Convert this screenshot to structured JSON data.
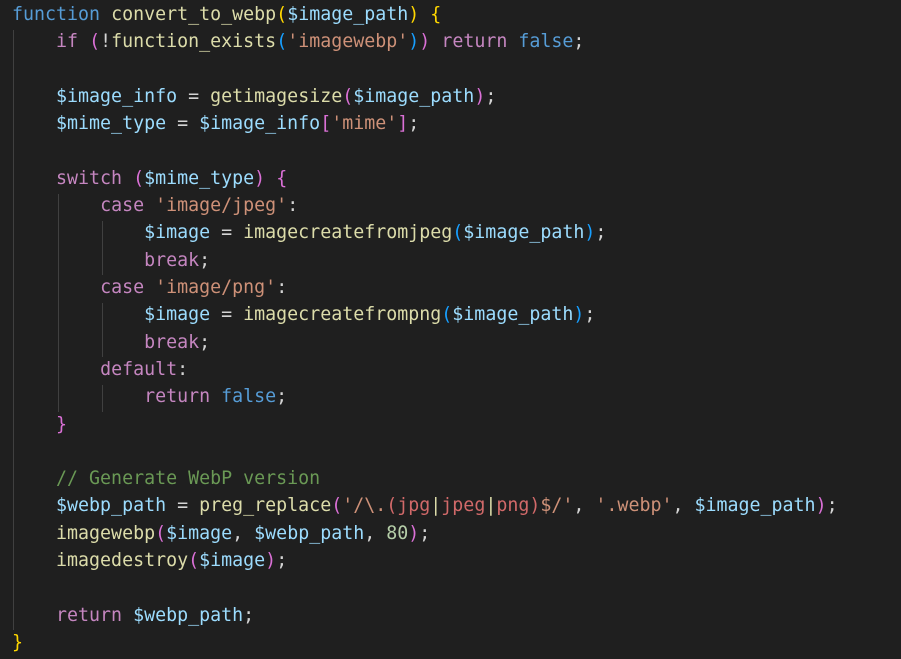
{
  "editor": {
    "language": "php",
    "theme_colors": {
      "background": "#1f1f1f",
      "keyword": "#569cd6",
      "control": "#c586c0",
      "function": "#dcdcaa",
      "variable": "#9cdcfe",
      "string": "#ce9178",
      "regex": "#d16969",
      "number": "#b5cea8",
      "comment": "#6a9955",
      "bracket_1": "#ffd700",
      "bracket_2": "#da70d6",
      "bracket_3": "#179fff"
    },
    "lines": [
      [
        [
          "kw",
          "function"
        ],
        [
          "op",
          " "
        ],
        [
          "fn",
          "convert_to_webp"
        ],
        [
          "p1",
          "("
        ],
        [
          "var",
          "$image_path"
        ],
        [
          "p1",
          ")"
        ],
        [
          "op",
          " "
        ],
        [
          "p1",
          "{"
        ]
      ],
      [
        [
          "op",
          "    "
        ],
        [
          "ctrl",
          "if"
        ],
        [
          "op",
          " "
        ],
        [
          "p2",
          "("
        ],
        [
          "op",
          "!"
        ],
        [
          "fn",
          "function_exists"
        ],
        [
          "p3",
          "("
        ],
        [
          "str",
          "'imagewebp'"
        ],
        [
          "p3",
          ")"
        ],
        [
          "p2",
          ")"
        ],
        [
          "op",
          " "
        ],
        [
          "ctrl",
          "return"
        ],
        [
          "op",
          " "
        ],
        [
          "kw",
          "false"
        ],
        [
          "op",
          ";"
        ]
      ],
      [],
      [
        [
          "op",
          "    "
        ],
        [
          "var",
          "$image_info"
        ],
        [
          "op",
          " = "
        ],
        [
          "fn",
          "getimagesize"
        ],
        [
          "p2",
          "("
        ],
        [
          "var",
          "$image_path"
        ],
        [
          "p2",
          ")"
        ],
        [
          "op",
          ";"
        ]
      ],
      [
        [
          "op",
          "    "
        ],
        [
          "var",
          "$mime_type"
        ],
        [
          "op",
          " = "
        ],
        [
          "var",
          "$image_info"
        ],
        [
          "p2",
          "["
        ],
        [
          "str",
          "'mime'"
        ],
        [
          "p2",
          "]"
        ],
        [
          "op",
          ";"
        ]
      ],
      [],
      [
        [
          "op",
          "    "
        ],
        [
          "ctrl",
          "switch"
        ],
        [
          "op",
          " "
        ],
        [
          "p2",
          "("
        ],
        [
          "var",
          "$mime_type"
        ],
        [
          "p2",
          ")"
        ],
        [
          "op",
          " "
        ],
        [
          "p2",
          "{"
        ]
      ],
      [
        [
          "op",
          "        "
        ],
        [
          "ctrl",
          "case"
        ],
        [
          "op",
          " "
        ],
        [
          "str",
          "'image/jpeg'"
        ],
        [
          "op",
          ":"
        ]
      ],
      [
        [
          "op",
          "            "
        ],
        [
          "var",
          "$image"
        ],
        [
          "op",
          " = "
        ],
        [
          "fn",
          "imagecreatefromjpeg"
        ],
        [
          "p3",
          "("
        ],
        [
          "var",
          "$image_path"
        ],
        [
          "p3",
          ")"
        ],
        [
          "op",
          ";"
        ]
      ],
      [
        [
          "op",
          "            "
        ],
        [
          "ctrl",
          "break"
        ],
        [
          "op",
          ";"
        ]
      ],
      [
        [
          "op",
          "        "
        ],
        [
          "ctrl",
          "case"
        ],
        [
          "op",
          " "
        ],
        [
          "str",
          "'image/png'"
        ],
        [
          "op",
          ":"
        ]
      ],
      [
        [
          "op",
          "            "
        ],
        [
          "var",
          "$image"
        ],
        [
          "op",
          " = "
        ],
        [
          "fn",
          "imagecreatefrompng"
        ],
        [
          "p3",
          "("
        ],
        [
          "var",
          "$image_path"
        ],
        [
          "p3",
          ")"
        ],
        [
          "op",
          ";"
        ]
      ],
      [
        [
          "op",
          "            "
        ],
        [
          "ctrl",
          "break"
        ],
        [
          "op",
          ";"
        ]
      ],
      [
        [
          "op",
          "        "
        ],
        [
          "ctrl",
          "default"
        ],
        [
          "op",
          ":"
        ]
      ],
      [
        [
          "op",
          "            "
        ],
        [
          "ctrl",
          "return"
        ],
        [
          "op",
          " "
        ],
        [
          "kw",
          "false"
        ],
        [
          "op",
          ";"
        ]
      ],
      [
        [
          "op",
          "    "
        ],
        [
          "p2",
          "}"
        ]
      ],
      [],
      [
        [
          "op",
          "    "
        ],
        [
          "cmt",
          "// Generate WebP version"
        ]
      ],
      [
        [
          "op",
          "    "
        ],
        [
          "var",
          "$webp_path"
        ],
        [
          "op",
          " = "
        ],
        [
          "fn",
          "preg_replace"
        ],
        [
          "p2",
          "("
        ],
        [
          "str",
          "'/\\."
        ],
        [
          "rx",
          "(jpg"
        ],
        [
          "rxop",
          "|"
        ],
        [
          "rx",
          "jpeg"
        ],
        [
          "rxop",
          "|"
        ],
        [
          "rx",
          "png)"
        ],
        [
          "str",
          "$/'"
        ],
        [
          "op",
          ", "
        ],
        [
          "str",
          "'.webp'"
        ],
        [
          "op",
          ", "
        ],
        [
          "var",
          "$image_path"
        ],
        [
          "p2",
          ")"
        ],
        [
          "op",
          ";"
        ]
      ],
      [
        [
          "op",
          "    "
        ],
        [
          "fn",
          "imagewebp"
        ],
        [
          "p2",
          "("
        ],
        [
          "var",
          "$image"
        ],
        [
          "op",
          ", "
        ],
        [
          "var",
          "$webp_path"
        ],
        [
          "op",
          ", "
        ],
        [
          "num",
          "80"
        ],
        [
          "p2",
          ")"
        ],
        [
          "op",
          ";"
        ]
      ],
      [
        [
          "op",
          "    "
        ],
        [
          "fn",
          "imagedestroy"
        ],
        [
          "p2",
          "("
        ],
        [
          "var",
          "$image"
        ],
        [
          "p2",
          ")"
        ],
        [
          "op",
          ";"
        ]
      ],
      [],
      [
        [
          "op",
          "    "
        ],
        [
          "ctrl",
          "return"
        ],
        [
          "op",
          " "
        ],
        [
          "var",
          "$webp_path"
        ],
        [
          "op",
          ";"
        ]
      ],
      [
        [
          "p1",
          "}"
        ]
      ]
    ]
  }
}
